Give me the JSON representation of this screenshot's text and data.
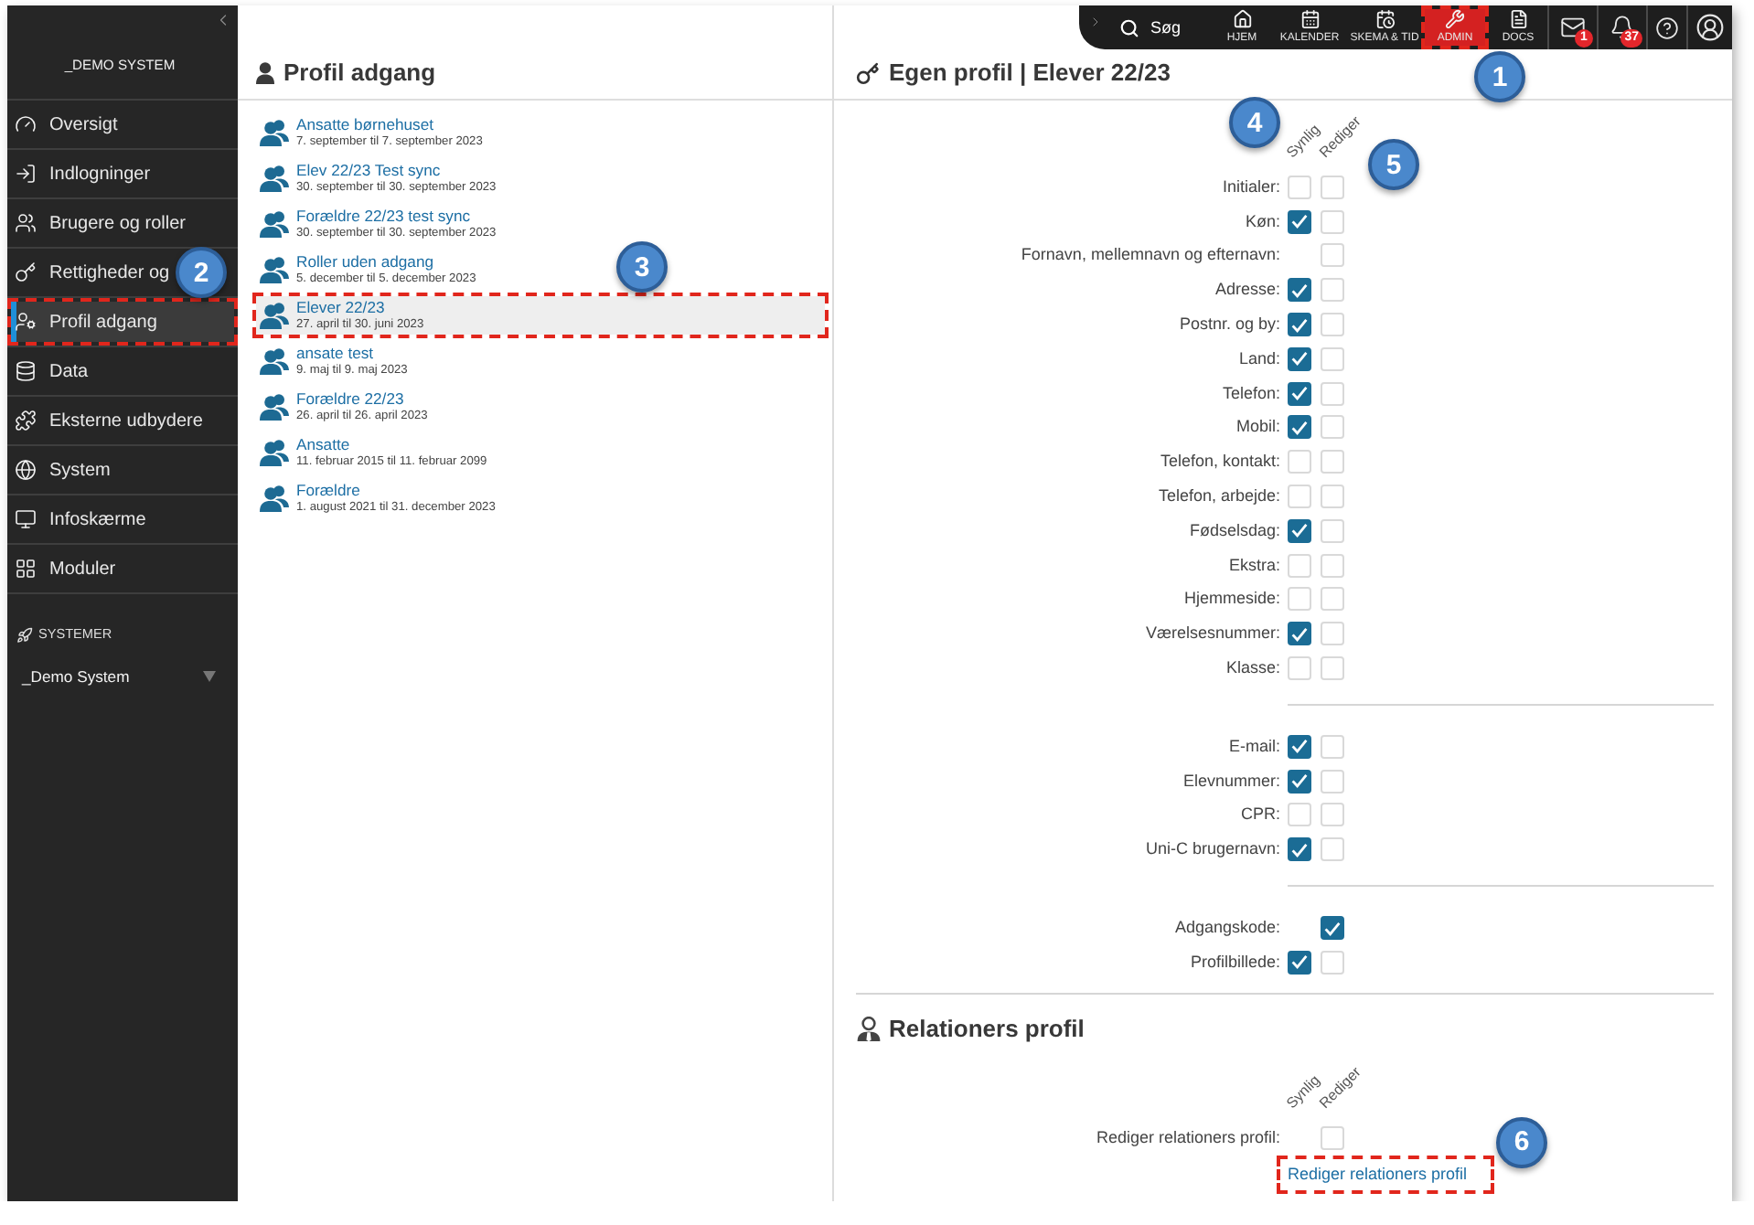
{
  "sidebar": {
    "title": "_DEMO SYSTEM",
    "items": [
      {
        "label": "Oversigt",
        "selected": false,
        "highlighted": false
      },
      {
        "label": "Indlogninger",
        "selected": false,
        "highlighted": false
      },
      {
        "label": "Brugere og roller",
        "selected": false,
        "highlighted": false
      },
      {
        "label": "Rettigheder og",
        "selected": false,
        "highlighted": false
      },
      {
        "label": "Profil adgang",
        "selected": true,
        "highlighted": true,
        "callout": "2"
      },
      {
        "label": "Data",
        "selected": false,
        "highlighted": false
      },
      {
        "label": "Eksterne udbydere",
        "selected": false,
        "highlighted": false
      },
      {
        "label": "System",
        "selected": false,
        "highlighted": false
      },
      {
        "label": "Infoskærme",
        "selected": false,
        "highlighted": false
      },
      {
        "label": "Moduler",
        "selected": false,
        "highlighted": false
      }
    ],
    "section_title": "SYSTEMER",
    "system_dropdown": {
      "value": "_Demo System"
    }
  },
  "top_bar": {
    "search_label": "Søg",
    "nav": [
      {
        "label": "HJEM",
        "selected": false,
        "highlighted": false
      },
      {
        "label": "KALENDER",
        "selected": false,
        "highlighted": false
      },
      {
        "label": "SKEMA & TID",
        "selected": false,
        "highlighted": false
      },
      {
        "label": "ADMIN",
        "selected": true,
        "highlighted": true,
        "callout": "1"
      },
      {
        "label": "DOCS",
        "selected": false,
        "highlighted": false
      }
    ],
    "mail_count": "1",
    "notification_count": "37"
  },
  "profile_list": {
    "title": "Profil adgang",
    "items": [
      {
        "name": "Ansatte børnehuset",
        "dates": "7. september til 7. september 2023",
        "selected": false,
        "highlighted": false
      },
      {
        "name": "Elev 22/23 Test sync",
        "dates": "30. september til 30. september 2023",
        "selected": false,
        "highlighted": false
      },
      {
        "name": "Forældre 22/23 test sync",
        "dates": "30. september til 30. september 2023",
        "selected": false,
        "highlighted": false
      },
      {
        "name": "Roller uden adgang",
        "dates": "5. december til 5. december 2023",
        "selected": false,
        "highlighted": false
      },
      {
        "name": "Elever 22/23",
        "dates": "27. april til 30. juni 2023",
        "selected": true,
        "highlighted": true,
        "callout": "3"
      },
      {
        "name": "ansate test",
        "dates": "9. maj til 9. maj 2023",
        "selected": false,
        "highlighted": false
      },
      {
        "name": "Forældre 22/23",
        "dates": "26. april til 26. april 2023",
        "selected": false,
        "highlighted": false
      },
      {
        "name": "Ansatte",
        "dates": "11. februar 2015 til 11. februar 2099",
        "selected": false,
        "highlighted": false
      },
      {
        "name": "Forældre",
        "dates": "1. august 2021 til 31. december 2023",
        "selected": false,
        "highlighted": false
      }
    ]
  },
  "profile_settings": {
    "title": "Egen profil | Elever 22/23",
    "columns": [
      {
        "label": "Synlig",
        "callout": "4"
      },
      {
        "label": "Rediger",
        "callout": "5"
      }
    ],
    "groups": [
      {
        "rows": [
          {
            "label": "Initialer:",
            "synlig": false,
            "rediger": false
          },
          {
            "label": "Køn:",
            "synlig": true,
            "rediger": false
          },
          {
            "label": "Fornavn, mellemnavn og efternavn:",
            "rediger": false
          },
          {
            "label": "Adresse:",
            "synlig": true,
            "rediger": false
          },
          {
            "label": "Postnr. og by:",
            "synlig": true,
            "rediger": false
          },
          {
            "label": "Land:",
            "synlig": true,
            "rediger": false
          },
          {
            "label": "Telefon:",
            "synlig": true,
            "rediger": false
          },
          {
            "label": "Mobil:",
            "synlig": true,
            "rediger": false
          },
          {
            "label": "Telefon, kontakt:",
            "synlig": false,
            "rediger": false
          },
          {
            "label": "Telefon, arbejde:",
            "synlig": false,
            "rediger": false
          },
          {
            "label": "Fødselsdag:",
            "synlig": true,
            "rediger": false
          },
          {
            "label": "Ekstra:",
            "synlig": false,
            "rediger": false
          },
          {
            "label": "Hjemmeside:",
            "synlig": false,
            "rediger": false
          },
          {
            "label": "Værelsesnummer:",
            "synlig": true,
            "rediger": false
          },
          {
            "label": "Klasse:",
            "synlig": false,
            "rediger": false
          }
        ]
      },
      {
        "rows": [
          {
            "label": "E-mail:",
            "synlig": true,
            "rediger": false
          },
          {
            "label": "Elevnummer:",
            "synlig": true,
            "rediger": false
          },
          {
            "label": "CPR:",
            "synlig": false,
            "rediger": false
          },
          {
            "label": "Uni-C brugernavn:",
            "synlig": true,
            "rediger": false
          }
        ]
      },
      {
        "rows": [
          {
            "label": "Adgangskode:",
            "rediger": true
          },
          {
            "label": "Profilbillede:",
            "synlig": true,
            "rediger": false
          }
        ]
      }
    ]
  },
  "relations_profile": {
    "title": "Relationers profil",
    "columns": [
      {
        "label": "Synlig"
      },
      {
        "label": "Rediger"
      }
    ],
    "rows": [
      {
        "label": "Rediger relationers profil:",
        "rediger": false
      }
    ],
    "link": {
      "label": "Rediger relationers profil",
      "highlighted": true,
      "callout": "6"
    }
  }
}
